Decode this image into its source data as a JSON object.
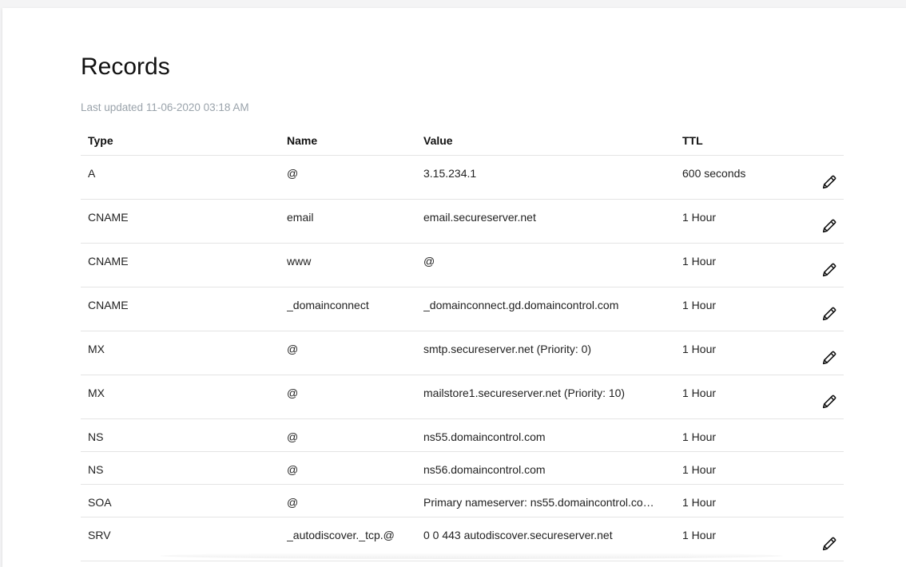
{
  "page": {
    "title": "Records",
    "last_updated": "Last updated 11-06-2020 03:18 AM"
  },
  "table": {
    "headers": [
      "Type",
      "Name",
      "Value",
      "TTL"
    ],
    "rows": [
      {
        "type": "A",
        "name": "@",
        "value": "3.15.234.1",
        "ttl": "600 seconds",
        "editable": true
      },
      {
        "type": "CNAME",
        "name": "email",
        "value": "email.secureserver.net",
        "ttl": "1 Hour",
        "editable": true
      },
      {
        "type": "CNAME",
        "name": "www",
        "value": "@",
        "ttl": "1 Hour",
        "editable": true
      },
      {
        "type": "CNAME",
        "name": "_domainconnect",
        "value": "_domainconnect.gd.domaincontrol.com",
        "ttl": "1 Hour",
        "editable": true
      },
      {
        "type": "MX",
        "name": "@",
        "value": "smtp.secureserver.net (Priority: 0)",
        "ttl": "1 Hour",
        "editable": true
      },
      {
        "type": "MX",
        "name": "@",
        "value": "mailstore1.secureserver.net (Priority: 10)",
        "ttl": "1 Hour",
        "editable": true
      },
      {
        "type": "NS",
        "name": "@",
        "value": "ns55.domaincontrol.com",
        "ttl": "1 Hour",
        "editable": false
      },
      {
        "type": "NS",
        "name": "@",
        "value": "ns56.domaincontrol.com",
        "ttl": "1 Hour",
        "editable": false
      },
      {
        "type": "SOA",
        "name": "@",
        "value": "Primary nameserver: ns55.domaincontrol.co…",
        "ttl": "1 Hour",
        "editable": false
      },
      {
        "type": "SRV",
        "name": "_autodiscover._tcp.@",
        "value": "0 0 443 autodiscover.secureserver.net",
        "ttl": "1 Hour",
        "editable": true
      }
    ]
  },
  "icons": {
    "edit": "pencil-icon"
  }
}
